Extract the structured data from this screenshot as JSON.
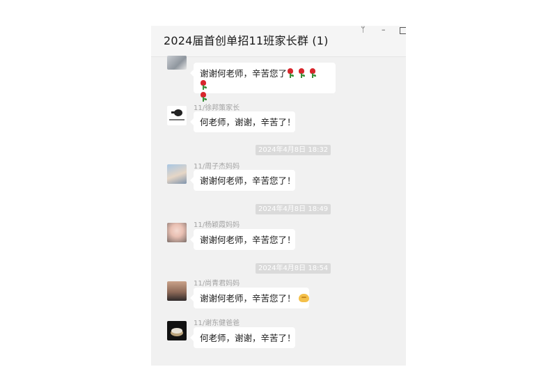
{
  "window": {
    "title": "2024届首创单招11班家长群 (1)",
    "controls": {
      "pin": "ᛘ",
      "min": "–"
    }
  },
  "messages": [
    {
      "text": "谢谢何老师，辛苦您了"
    },
    {
      "sender": "11/徐邦策家长",
      "text": "何老师，谢谢，辛苦了！"
    },
    {
      "sender": "11/周子杰妈妈",
      "text": "谢谢何老师，辛苦您了！"
    },
    {
      "sender": "11/杨颖霞妈妈",
      "text": "谢谢何老师，辛苦您了！"
    },
    {
      "sender": "11/尚青君妈妈",
      "text": "谢谢何老师，辛苦您了！"
    },
    {
      "sender": "11/谢东健爸爸",
      "text": "何老师，谢谢，辛苦了！"
    }
  ],
  "timestamps": [
    "2024年4月8日 18:32",
    "2024年4月8日 18:49",
    "2024年4月8日 18:54"
  ],
  "colors": {
    "background": "#f1f1f1",
    "bubble": "#ffffff",
    "time_badge": "#dadada",
    "sender": "#a3a3a3"
  }
}
